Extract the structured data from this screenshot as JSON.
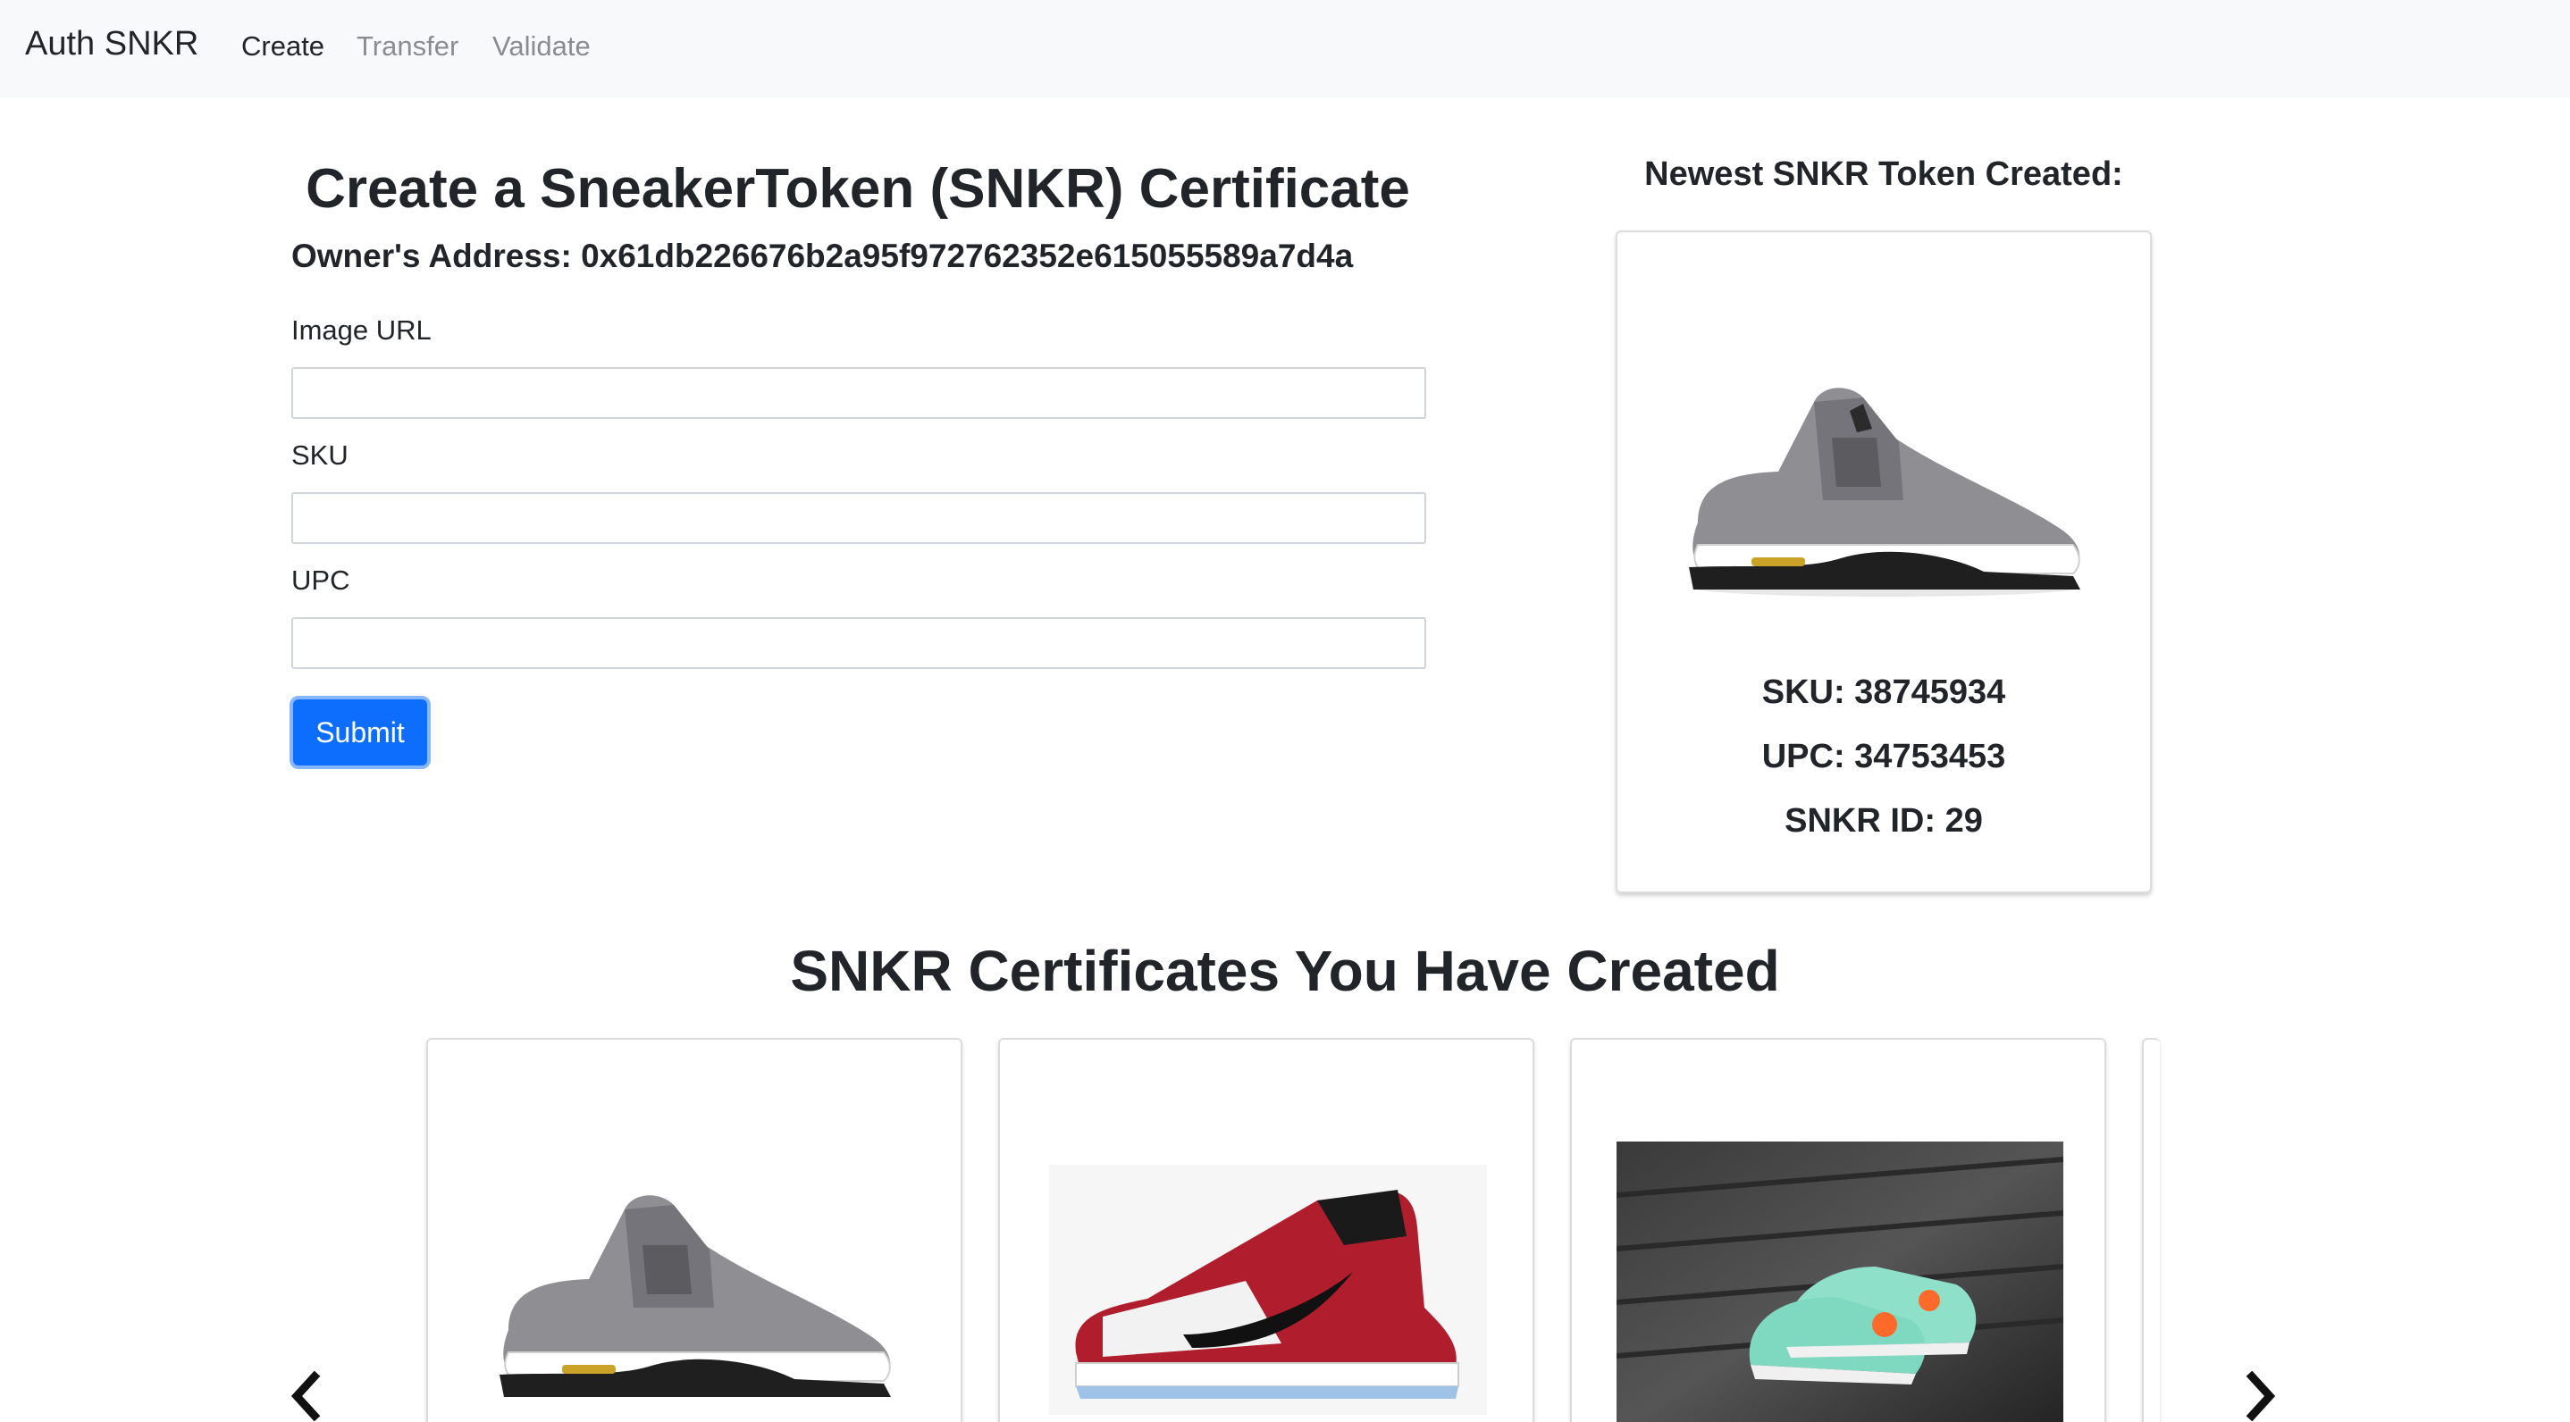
{
  "navbar": {
    "brand": "Auth SNKR",
    "links": [
      {
        "label": "Create",
        "active": true
      },
      {
        "label": "Transfer",
        "active": false
      },
      {
        "label": "Validate",
        "active": false
      }
    ]
  },
  "form": {
    "title": "Create a SneakerToken (SNKR) Certificate",
    "owner_address": "Owner's Address: 0x61db226676b2a95f972762352e615055589a7d4a",
    "fields": [
      {
        "label": "Image URL",
        "value": ""
      },
      {
        "label": "SKU",
        "value": ""
      },
      {
        "label": "UPC",
        "value": ""
      }
    ],
    "submit_label": "Submit"
  },
  "newest": {
    "title": "Newest SNKR Token Created:",
    "image": "grey-sneaker-icon",
    "sku": "SKU: 38745934",
    "upc": "UPC: 34753453",
    "snkr_id": "SNKR ID: 29"
  },
  "certificates": {
    "title": "SNKR Certificates You Have Created",
    "cards": [
      {
        "image": "grey-sneaker-icon"
      },
      {
        "image": "red-sneaker-icon"
      },
      {
        "image": "mint-sneaker-photo"
      }
    ],
    "prev_icon": "chevron-left-icon",
    "next_icon": "chevron-right-icon"
  },
  "colors": {
    "primary": "#0d6efd",
    "navbar_bg": "#f8f9fa",
    "text": "#212529",
    "muted": "#8a8d90"
  }
}
